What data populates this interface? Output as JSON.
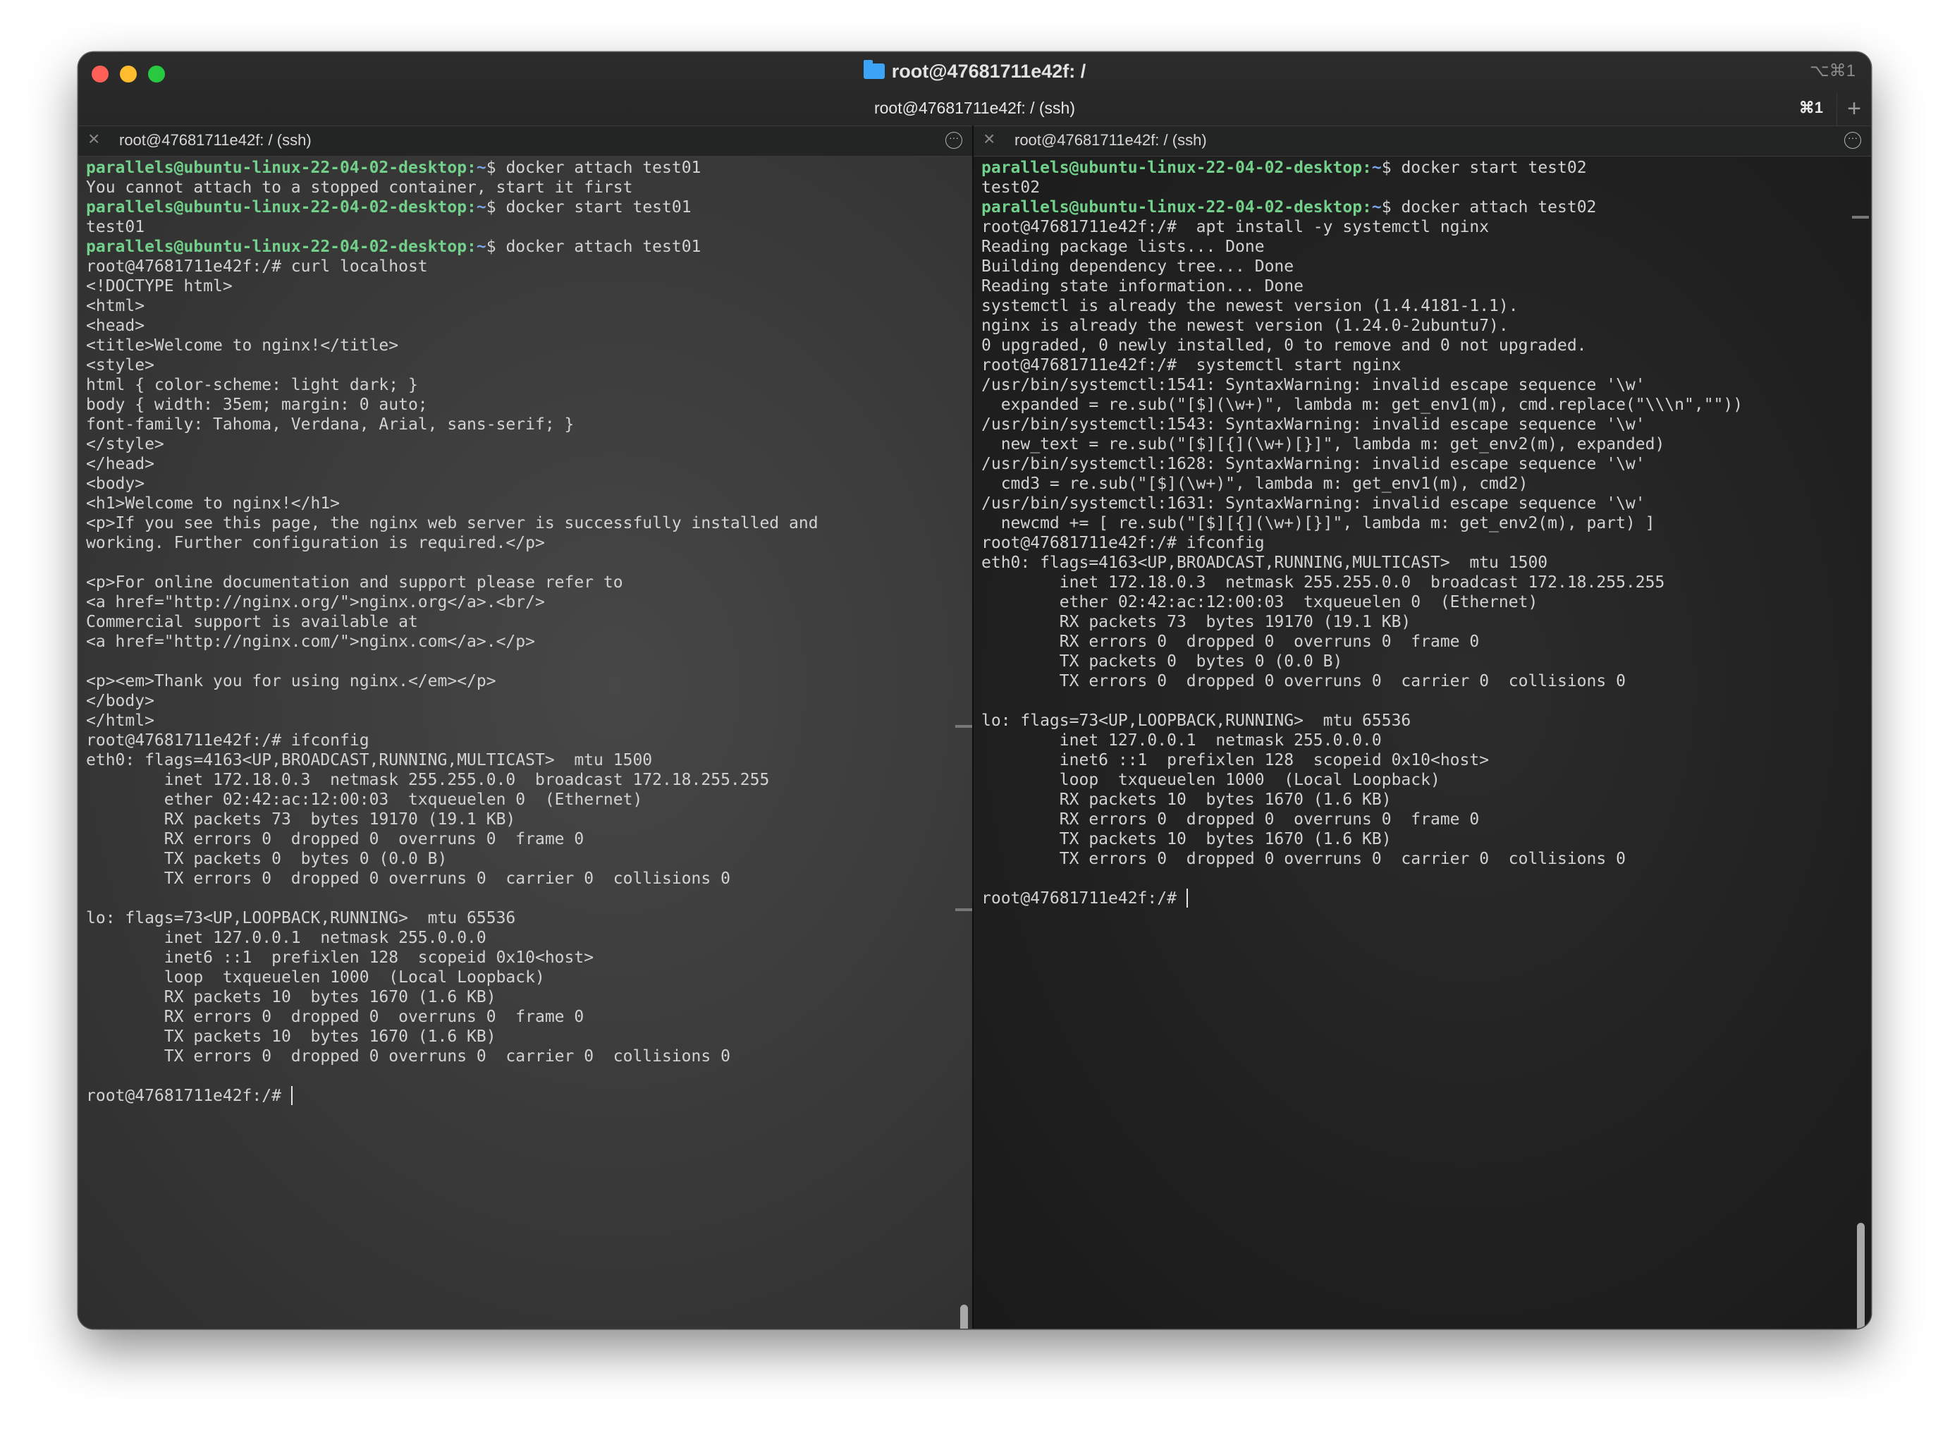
{
  "window": {
    "title": "root@47681711e42f: /",
    "shortcut_window": "⌥⌘1",
    "tab_title": "root@47681711e42f: / (ssh)",
    "tab_shortcut": "⌘1",
    "new_tab": "+"
  },
  "left_pane": {
    "title": "root@47681711e42f: / (ssh)",
    "lines": [
      {
        "user": "parallels@ubuntu-linux-22-04-02-desktop",
        "path": "~",
        "cmd": "$ docker attach test01"
      },
      {
        "text": "You cannot attach to a stopped container, start it first"
      },
      {
        "user": "parallels@ubuntu-linux-22-04-02-desktop",
        "path": "~",
        "cmd": "$ docker start test01"
      },
      {
        "text": "test01"
      },
      {
        "user": "parallels@ubuntu-linux-22-04-02-desktop",
        "path": "~",
        "cmd": "$ docker attach test01"
      },
      {
        "text": "root@47681711e42f:/# curl localhost"
      },
      {
        "text": "<!DOCTYPE html>"
      },
      {
        "text": "<html>"
      },
      {
        "text": "<head>"
      },
      {
        "text": "<title>Welcome to nginx!</title>"
      },
      {
        "text": "<style>"
      },
      {
        "text": "html { color-scheme: light dark; }"
      },
      {
        "text": "body { width: 35em; margin: 0 auto;"
      },
      {
        "text": "font-family: Tahoma, Verdana, Arial, sans-serif; }"
      },
      {
        "text": "</style>"
      },
      {
        "text": "</head>"
      },
      {
        "text": "<body>"
      },
      {
        "text": "<h1>Welcome to nginx!</h1>"
      },
      {
        "text": "<p>If you see this page, the nginx web server is successfully installed and"
      },
      {
        "text": "working. Further configuration is required.</p>"
      },
      {
        "text": ""
      },
      {
        "text": "<p>For online documentation and support please refer to"
      },
      {
        "text": "<a href=\"http://nginx.org/\">nginx.org</a>.<br/>"
      },
      {
        "text": "Commercial support is available at"
      },
      {
        "text": "<a href=\"http://nginx.com/\">nginx.com</a>.</p>"
      },
      {
        "text": ""
      },
      {
        "text": "<p><em>Thank you for using nginx.</em></p>"
      },
      {
        "text": "</body>"
      },
      {
        "text": "</html>"
      },
      {
        "text": "root@47681711e42f:/# ifconfig"
      },
      {
        "text": "eth0: flags=4163<UP,BROADCAST,RUNNING,MULTICAST>  mtu 1500"
      },
      {
        "text": "        inet 172.18.0.3  netmask 255.255.0.0  broadcast 172.18.255.255"
      },
      {
        "text": "        ether 02:42:ac:12:00:03  txqueuelen 0  (Ethernet)"
      },
      {
        "text": "        RX packets 73  bytes 19170 (19.1 KB)"
      },
      {
        "text": "        RX errors 0  dropped 0  overruns 0  frame 0"
      },
      {
        "text": "        TX packets 0  bytes 0 (0.0 B)"
      },
      {
        "text": "        TX errors 0  dropped 0 overruns 0  carrier 0  collisions 0"
      },
      {
        "text": ""
      },
      {
        "text": "lo: flags=73<UP,LOOPBACK,RUNNING>  mtu 65536"
      },
      {
        "text": "        inet 127.0.0.1  netmask 255.0.0.0"
      },
      {
        "text": "        inet6 ::1  prefixlen 128  scopeid 0x10<host>"
      },
      {
        "text": "        loop  txqueuelen 1000  (Local Loopback)"
      },
      {
        "text": "        RX packets 10  bytes 1670 (1.6 KB)"
      },
      {
        "text": "        RX errors 0  dropped 0  overruns 0  frame 0"
      },
      {
        "text": "        TX packets 10  bytes 1670 (1.6 KB)"
      },
      {
        "text": "        TX errors 0  dropped 0 overruns 0  carrier 0  collisions 0"
      },
      {
        "text": ""
      },
      {
        "text": "root@47681711e42f:/# ",
        "cursor": true
      }
    ]
  },
  "right_pane": {
    "title": "root@47681711e42f: / (ssh)",
    "lines": [
      {
        "user": "parallels@ubuntu-linux-22-04-02-desktop",
        "path": "~",
        "cmd": "$ docker start test02"
      },
      {
        "text": "test02"
      },
      {
        "user": "parallels@ubuntu-linux-22-04-02-desktop",
        "path": "~",
        "cmd": "$ docker attach test02"
      },
      {
        "text": "root@47681711e42f:/#  apt install -y systemctl nginx"
      },
      {
        "text": "Reading package lists... Done"
      },
      {
        "text": "Building dependency tree... Done"
      },
      {
        "text": "Reading state information... Done"
      },
      {
        "text": "systemctl is already the newest version (1.4.4181-1.1)."
      },
      {
        "text": "nginx is already the newest version (1.24.0-2ubuntu7)."
      },
      {
        "text": "0 upgraded, 0 newly installed, 0 to remove and 0 not upgraded."
      },
      {
        "text": "root@47681711e42f:/#  systemctl start nginx"
      },
      {
        "text": "/usr/bin/systemctl:1541: SyntaxWarning: invalid escape sequence '\\w'"
      },
      {
        "text": "  expanded = re.sub(\"[$](\\w+)\", lambda m: get_env1(m), cmd.replace(\"\\\\\\n\",\"\"))"
      },
      {
        "text": "/usr/bin/systemctl:1543: SyntaxWarning: invalid escape sequence '\\w'"
      },
      {
        "text": "  new_text = re.sub(\"[$][{](\\w+)[}]\", lambda m: get_env2(m), expanded)"
      },
      {
        "text": "/usr/bin/systemctl:1628: SyntaxWarning: invalid escape sequence '\\w'"
      },
      {
        "text": "  cmd3 = re.sub(\"[$](\\w+)\", lambda m: get_env1(m), cmd2)"
      },
      {
        "text": "/usr/bin/systemctl:1631: SyntaxWarning: invalid escape sequence '\\w'"
      },
      {
        "text": "  newcmd += [ re.sub(\"[$][{](\\w+)[}]\", lambda m: get_env2(m), part) ]"
      },
      {
        "text": "root@47681711e42f:/# ifconfig"
      },
      {
        "text": "eth0: flags=4163<UP,BROADCAST,RUNNING,MULTICAST>  mtu 1500"
      },
      {
        "text": "        inet 172.18.0.3  netmask 255.255.0.0  broadcast 172.18.255.255"
      },
      {
        "text": "        ether 02:42:ac:12:00:03  txqueuelen 0  (Ethernet)"
      },
      {
        "text": "        RX packets 73  bytes 19170 (19.1 KB)"
      },
      {
        "text": "        RX errors 0  dropped 0  overruns 0  frame 0"
      },
      {
        "text": "        TX packets 0  bytes 0 (0.0 B)"
      },
      {
        "text": "        TX errors 0  dropped 0 overruns 0  carrier 0  collisions 0"
      },
      {
        "text": ""
      },
      {
        "text": "lo: flags=73<UP,LOOPBACK,RUNNING>  mtu 65536"
      },
      {
        "text": "        inet 127.0.0.1  netmask 255.0.0.0"
      },
      {
        "text": "        inet6 ::1  prefixlen 128  scopeid 0x10<host>"
      },
      {
        "text": "        loop  txqueuelen 1000  (Local Loopback)"
      },
      {
        "text": "        RX packets 10  bytes 1670 (1.6 KB)"
      },
      {
        "text": "        RX errors 0  dropped 0  overruns 0  frame 0"
      },
      {
        "text": "        TX packets 10  bytes 1670 (1.6 KB)"
      },
      {
        "text": "        TX errors 0  dropped 0 overruns 0  carrier 0  collisions 0"
      },
      {
        "text": ""
      },
      {
        "text": "root@47681711e42f:/# ",
        "cursor": true
      }
    ]
  },
  "colors": {
    "prompt_user": "#72d08a",
    "prompt_path": "#78a6e8",
    "close_button": "#fe5f57",
    "minimize_button": "#febc2e",
    "zoom_button": "#28c840"
  },
  "icons": [
    "folder-icon",
    "close-icon",
    "more-options-icon",
    "plus-icon"
  ]
}
